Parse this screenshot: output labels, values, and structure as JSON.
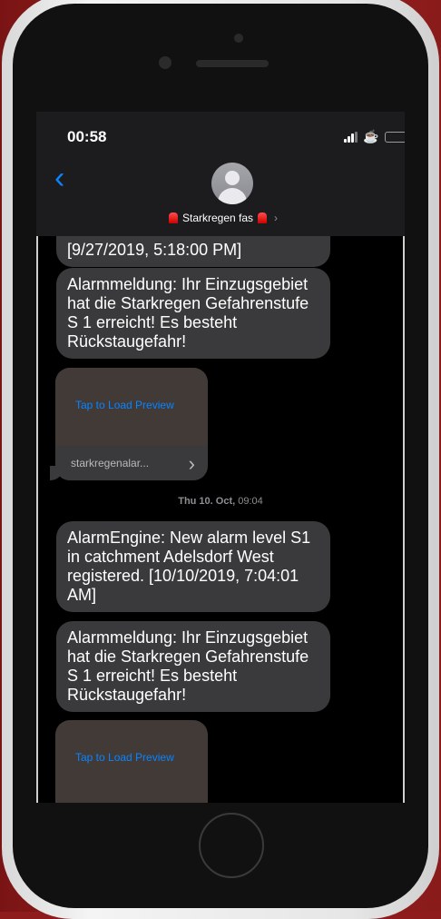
{
  "status_bar": {
    "time": "00:58"
  },
  "header": {
    "back_symbol": "‹",
    "contact_name": "Starkregen fas",
    "chevron": "›"
  },
  "thread": {
    "partial_message": "[9/27/2019, 5:18:00 PM]",
    "message_1": "Alarmmeldung: Ihr Einzugsgebiet hat die Starkregen Gefahrenstufe S 1 erreicht! Es besteht Rückstaugefahr!",
    "preview_1": {
      "label": "Tap to Load Preview",
      "domain": "starkregenalar...",
      "arrow": "›"
    },
    "timestamp": {
      "day": "Thu 10. Oct,",
      "time": "09:04"
    },
    "message_2": "AlarmEngine: New alarm level S1 in catchment Adelsdorf West registered. [10/10/2019, 7:04:01 AM]",
    "message_3": "Alarmmeldung: Ihr Einzugsgebiet hat die Starkregen Gefahrenstufe S 1 erreicht! Es besteht Rückstaugefahr!",
    "preview_2": {
      "label": "Tap to Load Preview"
    }
  },
  "colors": {
    "accent": "#0a84ff",
    "bubble": "#3a3a3c",
    "background": "#000000",
    "case": "#8e1c1c"
  }
}
